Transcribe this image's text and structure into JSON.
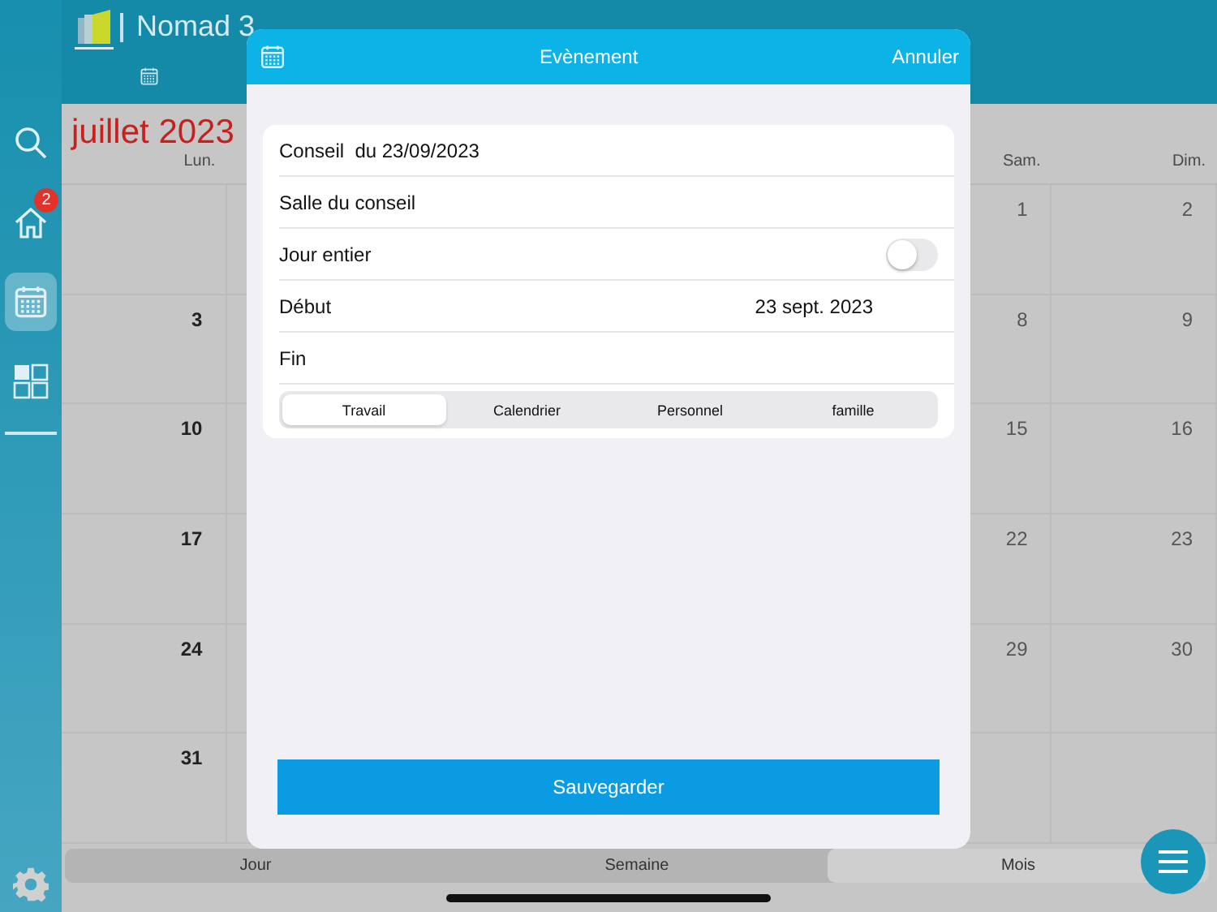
{
  "app": {
    "title": "Nomad 3"
  },
  "sidebar": {
    "items": [
      {
        "kind": "search",
        "selected": false
      },
      {
        "kind": "home",
        "selected": false,
        "badge": "2"
      },
      {
        "kind": "calendar",
        "selected": true
      },
      {
        "kind": "grid",
        "selected": false
      }
    ]
  },
  "calendar": {
    "month_title": "juillet 2023",
    "headers": {
      "mon": "Lun.",
      "sat": "Sam.",
      "sun": "Dim."
    },
    "weeks": [
      {
        "sat": "1",
        "sun": "2"
      },
      {
        "mon": "3",
        "sat": "8",
        "sun": "9"
      },
      {
        "mon": "10",
        "sat": "15",
        "sun": "16"
      },
      {
        "mon": "17",
        "sat": "22",
        "sun": "23"
      },
      {
        "mon": "24",
        "sat": "29",
        "sun": "30"
      },
      {
        "mon": "31"
      }
    ],
    "views": [
      {
        "label": "Jour",
        "selected": false
      },
      {
        "label": "Semaine",
        "selected": false
      },
      {
        "label": "Mois",
        "selected": true
      }
    ]
  },
  "dialog": {
    "title": "Evènement",
    "cancel": "Annuler",
    "title_field": {
      "value": "Conseil  du 23/09/2023"
    },
    "location_field": {
      "value": "Salle du conseil"
    },
    "all_day": {
      "label": "Jour entier",
      "on": false
    },
    "start": {
      "label": "Début",
      "value": "23 sept. 2023"
    },
    "end": {
      "label": "Fin"
    },
    "categories": [
      {
        "label": "Travail",
        "selected": true
      },
      {
        "label": "Calendrier",
        "selected": false
      },
      {
        "label": "Personnel",
        "selected": false
      },
      {
        "label": "famille",
        "selected": false
      }
    ],
    "save": "Sauvegarder"
  }
}
